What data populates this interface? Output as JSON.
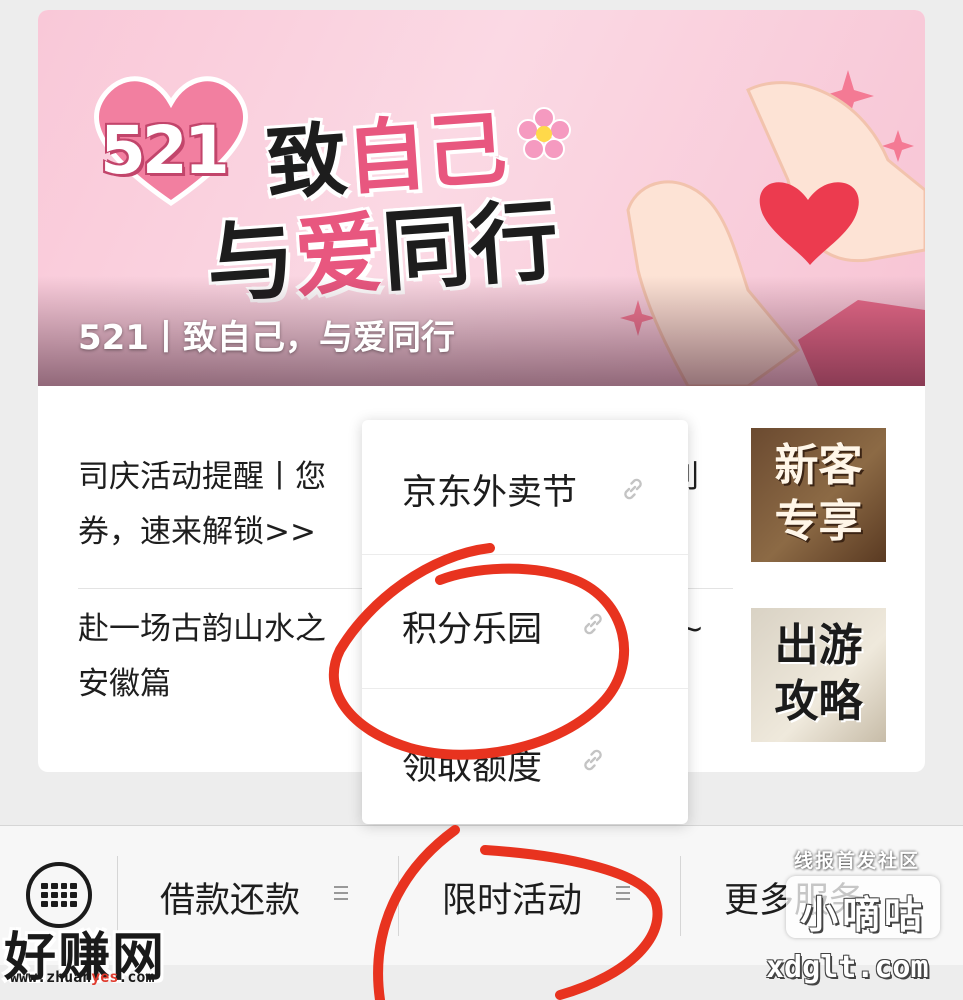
{
  "article": {
    "banner": {
      "number": "521",
      "line1_a": "致",
      "line1_b": "自己",
      "line2_a": "与",
      "line2_b": "爱",
      "line2_c": "同行",
      "caption": "521丨致自己，与爱同行"
    },
    "items": [
      {
        "title_line1": "司庆活动提醒丨您",
        "title_line1_tail": "利",
        "title_line2": "券，速来解锁>>",
        "thumb_text_line1": "新客",
        "thumb_text_line2": "专享"
      },
      {
        "title_line1": "赴一场古韵山水之",
        "title_line1_tail": "~",
        "title_line2": "安徽篇",
        "thumb_text_line1": "出游",
        "thumb_text_line2": "攻略"
      }
    ]
  },
  "popup_menu": {
    "items": [
      {
        "label": "京东外卖节",
        "icon": "link-icon"
      },
      {
        "label": "积分乐园",
        "icon": "link-icon"
      },
      {
        "label": "领取额度",
        "icon": "link-icon"
      }
    ]
  },
  "bottom_menu": {
    "keyboard_icon": "keyboard-icon",
    "items": [
      {
        "label": "借款还款",
        "icon": "menu-lines-icon"
      },
      {
        "label": "限时活动",
        "icon": "menu-lines-icon"
      },
      {
        "label": "更多服务",
        "icon": "menu-lines-icon"
      }
    ]
  },
  "watermarks": {
    "left_brand": "好赚网",
    "left_url_a": "www.zhuan",
    "left_url_b": "yes",
    "left_url_c": ".com",
    "right_top": "线报首发社区",
    "right_badge": "小嘀咕",
    "right_url": "xdglt.com"
  },
  "colors": {
    "annotation": "#e8331f",
    "accent_pink": "#e8577f",
    "banner_bg": "#f9c8d8"
  }
}
